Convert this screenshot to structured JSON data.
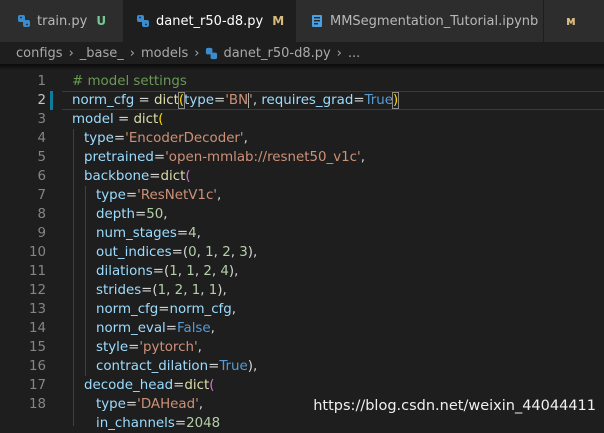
{
  "tabs": [
    {
      "label": "train.py",
      "status": "U",
      "active": false
    },
    {
      "label": "danet_r50-d8.py",
      "status": "M",
      "active": true
    },
    {
      "label": "MMSegmentation_Tutorial.ipynb",
      "status": "M",
      "active": false
    }
  ],
  "breadcrumb": [
    "configs",
    "_base_",
    "models",
    "danet_r50-d8.py",
    "..."
  ],
  "editor": {
    "current_line": 2,
    "line_numbers": [
      "1",
      "2",
      "3",
      "4",
      "5",
      "6",
      "7",
      "8",
      "9",
      "10",
      "11",
      "12",
      "13",
      "14",
      "15",
      "16",
      "17",
      "18"
    ],
    "lines": {
      "l1": {
        "comment": "# model settings"
      },
      "l2": {
        "a": "norm_cfg",
        "b": " = ",
        "c": "dict",
        "d": "(",
        "e": "type",
        "f": "=",
        "g": "'BN",
        "h": "'",
        "i": ", ",
        "j": "requires_grad",
        "k": "=",
        "l": "True",
        "m": ")"
      },
      "l3": {
        "a": "model",
        "b": " = ",
        "c": "dict",
        "d": "("
      },
      "l4": {
        "a": "type",
        "b": "=",
        "c": "'EncoderDecoder'",
        "d": ","
      },
      "l5": {
        "a": "pretrained",
        "b": "=",
        "c": "'open-mmlab://resnet50_v1c'",
        "d": ","
      },
      "l6": {
        "a": "backbone",
        "b": "=",
        "c": "dict",
        "d": "("
      },
      "l7": {
        "a": "type",
        "b": "=",
        "c": "'ResNetV1c'",
        "d": ","
      },
      "l8": {
        "a": "depth",
        "b": "=",
        "c": "50",
        "d": ","
      },
      "l9": {
        "a": "num_stages",
        "b": "=",
        "c": "4",
        "d": ","
      },
      "l10": {
        "a": "out_indices",
        "b": "=(",
        "c": "0",
        "d": ", ",
        "e": "1",
        "f": ", ",
        "g": "2",
        "h": ", ",
        "i": "3",
        "j": "),"
      },
      "l11": {
        "a": "dilations",
        "b": "=(",
        "c": "1",
        "d": ", ",
        "e": "1",
        "f": ", ",
        "g": "2",
        "h": ", ",
        "i": "4",
        "j": "),"
      },
      "l12": {
        "a": "strides",
        "b": "=(",
        "c": "1",
        "d": ", ",
        "e": "2",
        "f": ", ",
        "g": "1",
        "h": ", ",
        "i": "1",
        "j": "),"
      },
      "l13": {
        "a": "norm_cfg",
        "b": "=",
        "c": "norm_cfg",
        "d": ","
      },
      "l14": {
        "a": "norm_eval",
        "b": "=",
        "c": "False",
        "d": ","
      },
      "l15": {
        "a": "style",
        "b": "=",
        "c": "'pytorch'",
        "d": ","
      },
      "l16": {
        "a": "contract_dilation",
        "b": "=",
        "c": "True",
        "d": "),"
      },
      "l17": {
        "a": "decode_head",
        "b": "=",
        "c": "dict",
        "d": "("
      },
      "l18": {
        "a": "type",
        "b": "=",
        "c": "'DAHead'",
        "d": ","
      },
      "l19": {
        "a": "in_channels",
        "b": "=",
        "c": "2048"
      }
    }
  },
  "watermark": "https://blog.csdn.net/weixin_44044411",
  "colors": {
    "modified": "#d7ba7d",
    "python_icon": "#3a8ccf",
    "notebook_icon": "#4aa0e0",
    "accent": "#0c7d9d"
  }
}
